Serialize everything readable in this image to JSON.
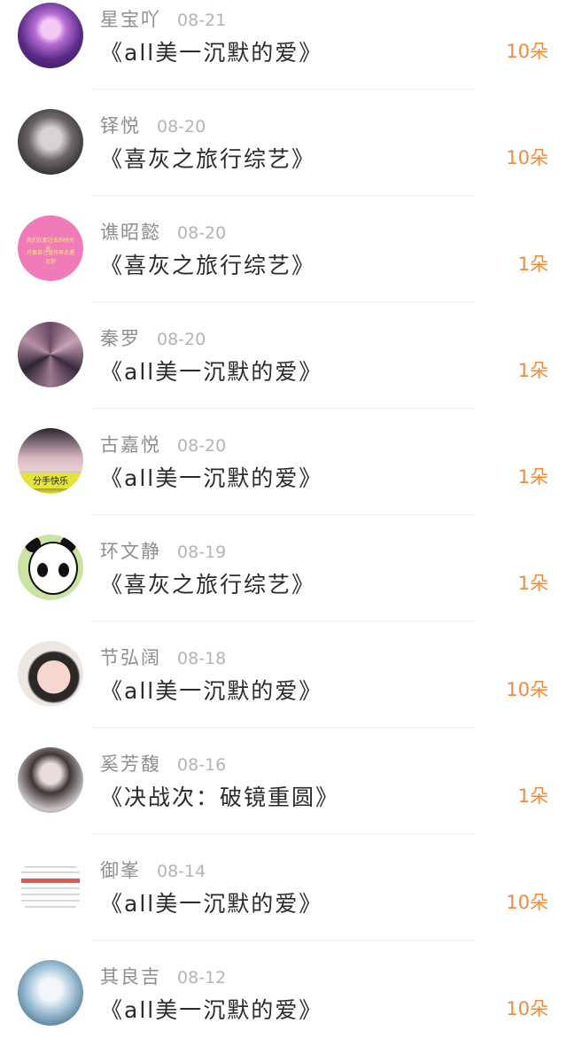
{
  "items": [
    {
      "name": "星宝吖",
      "date": "08-21",
      "title": "《all美一沉默的爱》",
      "count": "10朵"
    },
    {
      "name": "铎悦",
      "date": "08-20",
      "title": "《喜灰之旅行综艺》",
      "count": "10朵"
    },
    {
      "name": "谯昭懿",
      "date": "08-20",
      "title": "《喜灰之旅行综艺》",
      "count": "1朵",
      "avatar_text": [
        "我们在那过去的时光里，",
        "只恨自己没有早点遇见你"
      ]
    },
    {
      "name": "秦罗",
      "date": "08-20",
      "title": "《all美一沉默的爱》",
      "count": "1朵"
    },
    {
      "name": "古嘉悦",
      "date": "08-20",
      "title": "《all美一沉默的爱》",
      "count": "1朵",
      "avatar_text": [
        "分手快乐"
      ]
    },
    {
      "name": "环文静",
      "date": "08-19",
      "title": "《喜灰之旅行综艺》",
      "count": "1朵"
    },
    {
      "name": "节弘阔",
      "date": "08-18",
      "title": "《all美一沉默的爱》",
      "count": "10朵"
    },
    {
      "name": "奚芳馥",
      "date": "08-16",
      "title": "《决战次：破镜重圆》",
      "count": "1朵"
    },
    {
      "name": "御峯",
      "date": "08-14",
      "title": "《all美一沉默的爱》",
      "count": "10朵"
    },
    {
      "name": "其良吉",
      "date": "08-12",
      "title": "《all美一沉默的爱》",
      "count": "10朵"
    }
  ],
  "colors": {
    "count": "#f08a3c",
    "name": "#8e8e8e",
    "date": "#b4b4b4",
    "title": "#2a2a2a"
  }
}
